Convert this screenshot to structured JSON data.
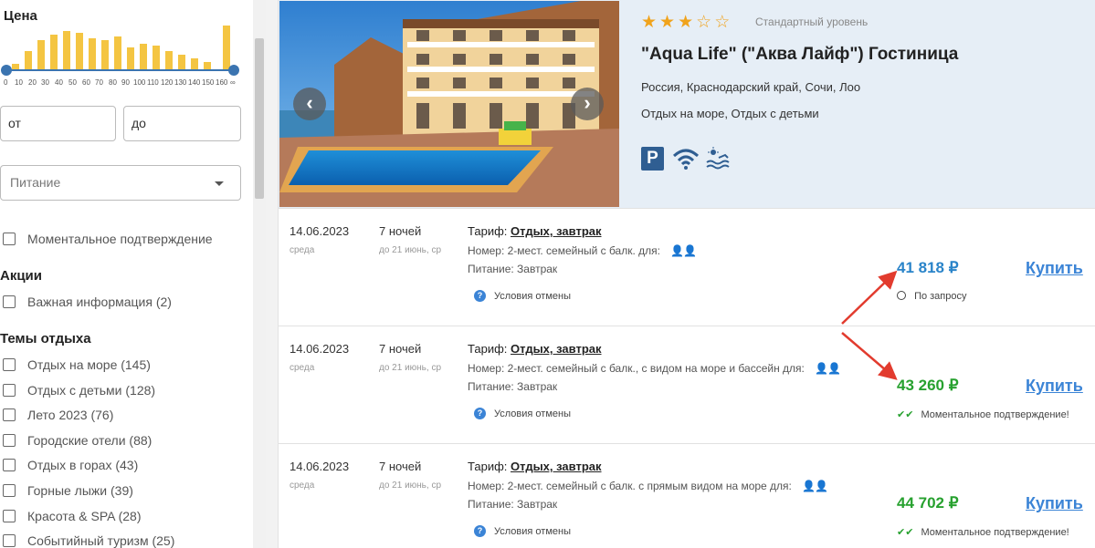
{
  "filters": {
    "price_title": "Цена",
    "price_ticks": [
      "0",
      "10",
      "20",
      "30",
      "40",
      "50",
      "60",
      "70",
      "80",
      "90",
      "100",
      "110",
      "120",
      "130",
      "140",
      "150",
      "160",
      "∞"
    ],
    "price_from_placeholder": "от",
    "price_to_placeholder": "до",
    "meal_select": "Питание",
    "instant_confirm": "Моментальное подтверждение",
    "promotions_title": "Акции",
    "promotions": [
      "Важная информация (2)"
    ],
    "themes_title": "Темы отдыха",
    "themes": [
      "Отдых на море (145)",
      "Отдых с детьми (128)",
      "Лето 2023 (76)",
      "Городские отели (88)",
      "Отдых в горах (43)",
      "Горные лыжи (39)",
      "Красота & SPA (28)",
      "Событийный туризм (25)"
    ]
  },
  "hotel": {
    "stars_filled": 3,
    "stars_total": 5,
    "level": "Стандартный уровень",
    "name": "\"Aqua Life\" (\"Аква Лайф\") Гостиница",
    "location": "Россия, Краснодарский край, Сочи, Лоо",
    "themes": "Отдых на море, Отдых с детьми",
    "amenities": [
      "parking-icon",
      "wifi-icon",
      "beach-icon"
    ],
    "parking_letter": "P"
  },
  "offers": [
    {
      "date": "14.06.2023",
      "weekday": "среда",
      "nights": "7 ночей",
      "until": "до 21 июнь, ср",
      "tariff_label": "Тариф:",
      "tariff": "Отдых, завтрак",
      "room": "Номер: 2-мест. семейный с балк.   для:",
      "meal": "Питание: Завтрак",
      "cancel": "Условия отмены",
      "price": "41 818 ₽",
      "price_color": "#2a84c9",
      "status": "По запросу",
      "buy": "Купить"
    },
    {
      "date": "14.06.2023",
      "weekday": "среда",
      "nights": "7 ночей",
      "until": "до 21 июнь, ср",
      "tariff_label": "Тариф:",
      "tariff": "Отдых, завтрак",
      "room": "Номер: 2-мест. семейный с балк., с видом на море и бассейн   для:",
      "meal": "Питание: Завтрак",
      "cancel": "Условия отмены",
      "price": "43 260 ₽",
      "price_color": "#27a12f",
      "status": "Моментальное подтверждение!",
      "buy": "Купить"
    },
    {
      "date": "14.06.2023",
      "weekday": "среда",
      "nights": "7 ночей",
      "until": "до 21 июнь, ср",
      "tariff_label": "Тариф:",
      "tariff": "Отдых, завтрак",
      "room": "Номер: 2-мест. семейный с балк. с прямым видом на море   для:",
      "meal": "Питание: Завтрак",
      "cancel": "Условия отмены",
      "price": "44 702 ₽",
      "price_color": "#27a12f",
      "status": "Моментальное подтверждение!",
      "buy": "Купить"
    }
  ],
  "colors": {
    "accent": "#3b84d6",
    "histogram": "#f4c542",
    "annotation_arrow": "#e23b2e"
  }
}
